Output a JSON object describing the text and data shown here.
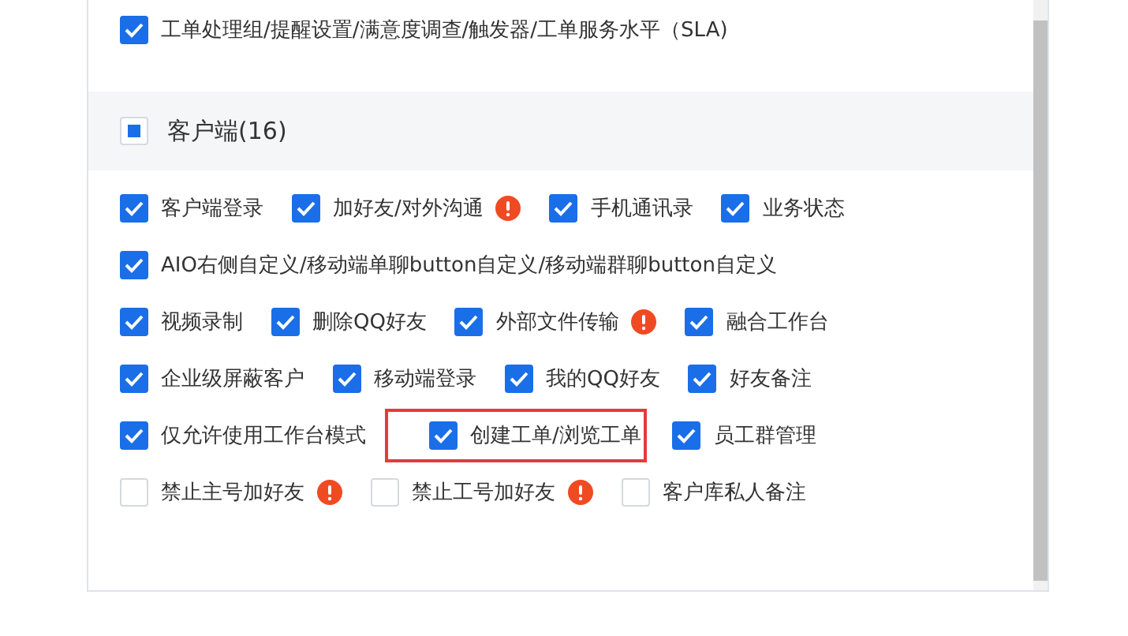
{
  "top_item": {
    "label": "工单处理组/提醒设置/满意度调查/触发器/工单服务水平（SLA)",
    "checked": true
  },
  "section": {
    "title": "客户端(16)",
    "indeterminate": true
  },
  "rows": [
    [
      {
        "label": "客户端登录",
        "checked": true,
        "warning": false,
        "highlighted": false
      },
      {
        "label": "加好友/对外沟通",
        "checked": true,
        "warning": true,
        "highlighted": false
      },
      {
        "label": "手机通讯录",
        "checked": true,
        "warning": false,
        "highlighted": false
      },
      {
        "label": "业务状态",
        "checked": true,
        "warning": false,
        "highlighted": false
      }
    ],
    [
      {
        "label": "AIO右侧自定义/移动端单聊button自定义/移动端群聊button自定义",
        "checked": true,
        "warning": false,
        "highlighted": false
      }
    ],
    [
      {
        "label": "视频录制",
        "checked": true,
        "warning": false,
        "highlighted": false
      },
      {
        "label": "删除QQ好友",
        "checked": true,
        "warning": false,
        "highlighted": false
      },
      {
        "label": "外部文件传输",
        "checked": true,
        "warning": true,
        "highlighted": false
      },
      {
        "label": "融合工作台",
        "checked": true,
        "warning": false,
        "highlighted": false
      }
    ],
    [
      {
        "label": "企业级屏蔽客户",
        "checked": true,
        "warning": false,
        "highlighted": false
      },
      {
        "label": "移动端登录",
        "checked": true,
        "warning": false,
        "highlighted": false
      },
      {
        "label": "我的QQ好友",
        "checked": true,
        "warning": false,
        "highlighted": false
      },
      {
        "label": "好友备注",
        "checked": true,
        "warning": false,
        "highlighted": false
      }
    ],
    [
      {
        "label": "仅允许使用工作台模式",
        "checked": true,
        "warning": false,
        "highlighted": false
      },
      {
        "label": "创建工单/浏览工单",
        "checked": true,
        "warning": false,
        "highlighted": true
      },
      {
        "label": "员工群管理",
        "checked": true,
        "warning": false,
        "highlighted": false
      }
    ],
    [
      {
        "label": "禁止主号加好友",
        "checked": false,
        "warning": true,
        "highlighted": false
      },
      {
        "label": "禁止工号加好友",
        "checked": false,
        "warning": true,
        "highlighted": false
      },
      {
        "label": "客户库私人备注",
        "checked": false,
        "warning": false,
        "highlighted": false
      }
    ]
  ]
}
